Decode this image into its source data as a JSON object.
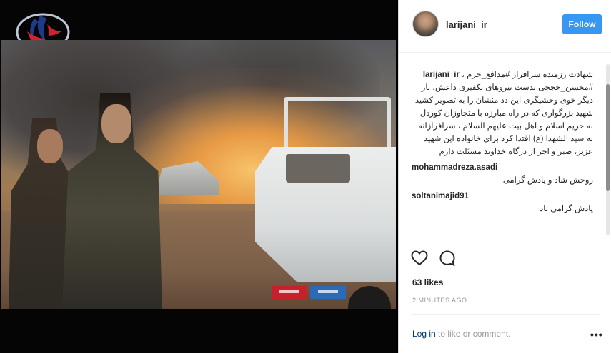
{
  "post": {
    "username": "larijani_ir",
    "follow_label": "Follow",
    "caption": {
      "user": "larijani_ir",
      "head": "شهادت رزمنده سرافراز #مدافع_حرم ،",
      "text": "#محسن_حججی بدست نیروهای تکفیری داعش، بار دیگر خوی وحشیگری این دد منشان را به تصویر کشید شهید بزرگواری که در راه مبارزه با متجاوزان کوردل به حریم اسلام و اهل بیت علیهم السلام ، سرافرازانه به سید الشهدا (ع) اقتدا کرد برای خانواده این شهید عزیز، صبر و اجر از درگاه خداوند مسئلت دارم"
    },
    "comments": [
      {
        "user": "mohammadreza.asadi",
        "text": "روحش شاد و یادش گرامی"
      },
      {
        "user": "soltanimajid91",
        "text": "یادش گرامی باد"
      }
    ],
    "likes": "63 likes",
    "time": "2 MINUTES AGO",
    "login_link": "Log in",
    "login_rest": " to like or comment.",
    "more_label": "•••"
  },
  "media": {
    "logo_icon": "channel-logo-icon",
    "badge_colors": {
      "red": "#c8202a",
      "blue": "#2a6ab6"
    }
  },
  "colors": {
    "follow_blue": "#3897f0",
    "link": "#003569"
  }
}
